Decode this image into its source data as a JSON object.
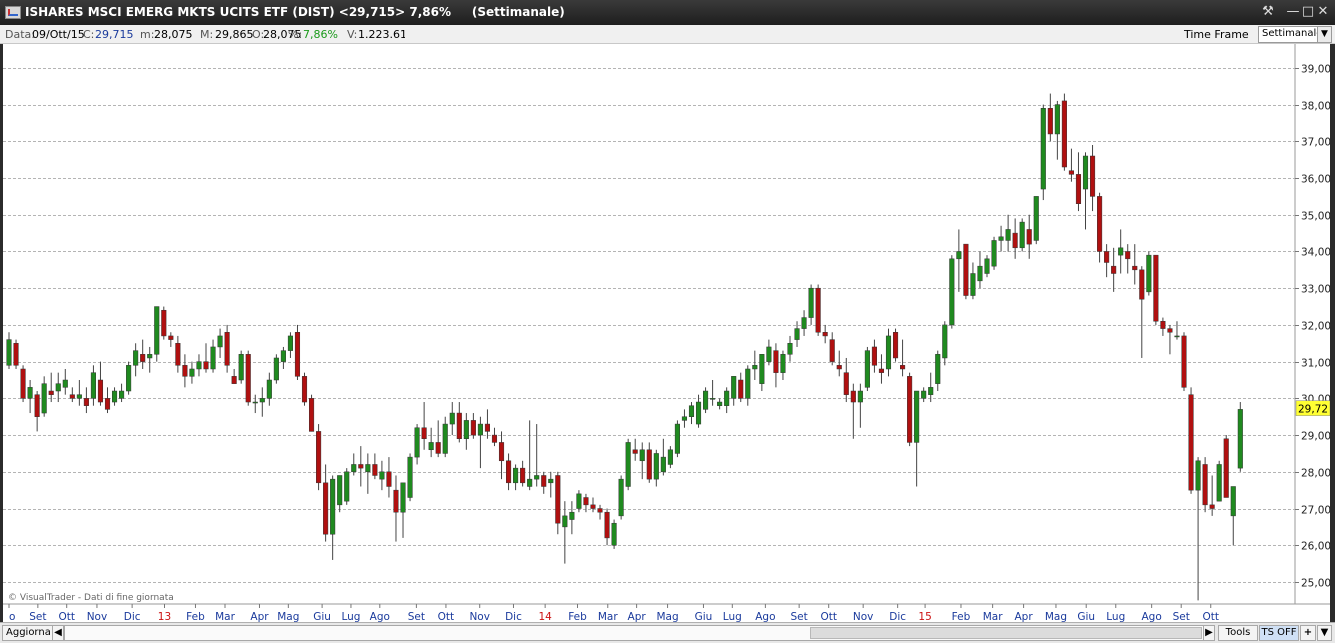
{
  "window": {
    "title": "ISHARES MSCI EMERG MKTS UCITS ETF (DIST) <29,715> 7,86%",
    "timeframe_title": "(Settimanale)"
  },
  "info_bar": {
    "data_label": "Data:",
    "data_value": "09/Ott/15",
    "close_label": "C:",
    "close_value": "29,715",
    "min_label": "m:",
    "min_value": "28,075",
    "max_label": "M:",
    "max_value": "29,865",
    "open_label": "O:",
    "open_value": "28,075",
    "pct_label": "%:",
    "pct_value": "7,86%",
    "vol_label": "V:",
    "vol_value": "1.223.619"
  },
  "time_frame_label": "Time Frame",
  "time_frame_selected": "Settimanale",
  "watermark": "© VisualTrader - Dati di fine giornata",
  "bottom": {
    "update_label": "Aggiorna",
    "tools_label": "Tools",
    "ts_label": "TS OFF",
    "plus_label": "+"
  },
  "colors": {
    "up": "#1f8a1f",
    "down": "#b01010",
    "last_price_bg": "#ffff33",
    "axis_month": "#1a3a9c",
    "axis_year": "#cc1111"
  },
  "chart_data": {
    "type": "candlestick",
    "ylim": [
      24.4,
      39.65
    ],
    "y_ticks": [
      "25,00",
      "26,00",
      "27,00",
      "28,00",
      "29,00",
      "30,00",
      "31,00",
      "32,00",
      "33,00",
      "34,00",
      "35,00",
      "36,00",
      "37,00",
      "38,00",
      "39,00"
    ],
    "last_price_label": "29,72",
    "x_labels": [
      {
        "t": "o",
        "i": 0
      },
      {
        "t": "Set",
        "i": 4.1
      },
      {
        "t": "Ott",
        "i": 8.2
      },
      {
        "t": "Nov",
        "i": 12.5
      },
      {
        "t": "Dic",
        "i": 17.5
      },
      {
        "t": "13",
        "i": 22.1,
        "year": true
      },
      {
        "t": "Feb",
        "i": 26.5
      },
      {
        "t": "Mar",
        "i": 30.7
      },
      {
        "t": "Apr",
        "i": 35.6
      },
      {
        "t": "Mag",
        "i": 39.7
      },
      {
        "t": "Giu",
        "i": 44.5
      },
      {
        "t": "Lug",
        "i": 48.6
      },
      {
        "t": "Ago",
        "i": 52.7
      },
      {
        "t": "Set",
        "i": 57.9
      },
      {
        "t": "Ott",
        "i": 62.1
      },
      {
        "t": "Nov",
        "i": 66.9
      },
      {
        "t": "Dic",
        "i": 71.7
      },
      {
        "t": "14",
        "i": 76.2,
        "year": true
      },
      {
        "t": "Feb",
        "i": 80.8
      },
      {
        "t": "Mar",
        "i": 85.1
      },
      {
        "t": "Apr",
        "i": 89.2
      },
      {
        "t": "Mag",
        "i": 93.6
      },
      {
        "t": "Giu",
        "i": 98.7
      },
      {
        "t": "Lug",
        "i": 102.8
      },
      {
        "t": "Ago",
        "i": 107.5
      },
      {
        "t": "Set",
        "i": 112.3
      },
      {
        "t": "Ott",
        "i": 116.5
      },
      {
        "t": "Nov",
        "i": 121.4
      },
      {
        "t": "Dic",
        "i": 126.3
      },
      {
        "t": "15",
        "i": 130.2,
        "year": true
      },
      {
        "t": "Feb",
        "i": 135.3
      },
      {
        "t": "Mar",
        "i": 139.8
      },
      {
        "t": "Apr",
        "i": 144.2
      },
      {
        "t": "Mag",
        "i": 148.8
      },
      {
        "t": "Giu",
        "i": 153.1
      },
      {
        "t": "Lug",
        "i": 157.3
      },
      {
        "t": "Ago",
        "i": 162.4
      },
      {
        "t": "Set",
        "i": 166.6
      },
      {
        "t": "Ott",
        "i": 170.8
      }
    ],
    "candles": [
      {
        "o": 30.9,
        "h": 31.8,
        "l": 30.8,
        "c": 31.6
      },
      {
        "o": 31.5,
        "h": 31.6,
        "l": 30.8,
        "c": 30.9
      },
      {
        "o": 30.8,
        "h": 30.9,
        "l": 29.9,
        "c": 30.0
      },
      {
        "o": 30.0,
        "h": 30.5,
        "l": 29.6,
        "c": 30.3
      },
      {
        "o": 30.1,
        "h": 30.2,
        "l": 29.1,
        "c": 29.5
      },
      {
        "o": 29.6,
        "h": 30.6,
        "l": 29.5,
        "c": 30.4
      },
      {
        "o": 30.2,
        "h": 30.7,
        "l": 29.9,
        "c": 30.1
      },
      {
        "o": 30.2,
        "h": 30.7,
        "l": 29.9,
        "c": 30.4
      },
      {
        "o": 30.3,
        "h": 30.8,
        "l": 30.1,
        "c": 30.5
      },
      {
        "o": 30.1,
        "h": 30.3,
        "l": 29.9,
        "c": 30.0
      },
      {
        "o": 30.0,
        "h": 30.5,
        "l": 29.8,
        "c": 30.1
      },
      {
        "o": 30.0,
        "h": 30.3,
        "l": 29.6,
        "c": 29.8
      },
      {
        "o": 30.0,
        "h": 30.9,
        "l": 29.8,
        "c": 30.7
      },
      {
        "o": 30.5,
        "h": 31.0,
        "l": 29.8,
        "c": 29.9
      },
      {
        "o": 30.0,
        "h": 30.3,
        "l": 29.6,
        "c": 29.7
      },
      {
        "o": 29.9,
        "h": 30.3,
        "l": 29.8,
        "c": 30.2
      },
      {
        "o": 30.0,
        "h": 30.4,
        "l": 29.9,
        "c": 30.2
      },
      {
        "o": 30.2,
        "h": 31.0,
        "l": 30.1,
        "c": 30.9
      },
      {
        "o": 30.9,
        "h": 31.5,
        "l": 30.6,
        "c": 31.3
      },
      {
        "o": 31.2,
        "h": 31.6,
        "l": 30.8,
        "c": 31.0
      },
      {
        "o": 31.1,
        "h": 31.4,
        "l": 30.7,
        "c": 31.2
      },
      {
        "o": 31.2,
        "h": 32.5,
        "l": 31.0,
        "c": 32.5
      },
      {
        "o": 32.4,
        "h": 32.5,
        "l": 31.6,
        "c": 31.7
      },
      {
        "o": 31.7,
        "h": 31.8,
        "l": 31.4,
        "c": 31.6
      },
      {
        "o": 31.5,
        "h": 31.7,
        "l": 30.7,
        "c": 30.9
      },
      {
        "o": 30.9,
        "h": 31.2,
        "l": 30.3,
        "c": 30.6
      },
      {
        "o": 30.6,
        "h": 31.0,
        "l": 30.4,
        "c": 30.8
      },
      {
        "o": 30.8,
        "h": 31.2,
        "l": 30.6,
        "c": 31.0
      },
      {
        "o": 31.0,
        "h": 31.5,
        "l": 30.7,
        "c": 30.8
      },
      {
        "o": 30.8,
        "h": 31.6,
        "l": 30.7,
        "c": 31.4
      },
      {
        "o": 31.4,
        "h": 31.9,
        "l": 31.1,
        "c": 31.7
      },
      {
        "o": 31.8,
        "h": 32.0,
        "l": 30.7,
        "c": 30.9
      },
      {
        "o": 30.6,
        "h": 30.8,
        "l": 30.4,
        "c": 30.4
      },
      {
        "o": 30.5,
        "h": 31.3,
        "l": 30.4,
        "c": 31.2
      },
      {
        "o": 31.2,
        "h": 31.3,
        "l": 29.8,
        "c": 29.9
      },
      {
        "o": 29.9,
        "h": 30.1,
        "l": 29.6,
        "c": 29.9
      },
      {
        "o": 29.9,
        "h": 30.3,
        "l": 29.5,
        "c": 30.0
      },
      {
        "o": 30.0,
        "h": 30.7,
        "l": 29.8,
        "c": 30.5
      },
      {
        "o": 30.5,
        "h": 31.2,
        "l": 30.4,
        "c": 31.1
      },
      {
        "o": 31.0,
        "h": 31.4,
        "l": 30.8,
        "c": 31.3
      },
      {
        "o": 31.3,
        "h": 31.8,
        "l": 31.1,
        "c": 31.7
      },
      {
        "o": 31.8,
        "h": 32.0,
        "l": 30.5,
        "c": 30.6
      },
      {
        "o": 30.6,
        "h": 30.7,
        "l": 29.8,
        "c": 29.9
      },
      {
        "o": 30.0,
        "h": 30.1,
        "l": 29.1,
        "c": 29.1
      },
      {
        "o": 29.1,
        "h": 29.3,
        "l": 27.5,
        "c": 27.7
      },
      {
        "o": 27.7,
        "h": 28.2,
        "l": 26.1,
        "c": 26.3
      },
      {
        "o": 26.3,
        "h": 27.9,
        "l": 25.6,
        "c": 27.8
      },
      {
        "o": 27.1,
        "h": 27.9,
        "l": 26.9,
        "c": 27.9
      },
      {
        "o": 27.2,
        "h": 28.1,
        "l": 27.1,
        "c": 28.0
      },
      {
        "o": 28.0,
        "h": 28.5,
        "l": 27.9,
        "c": 28.2
      },
      {
        "o": 28.2,
        "h": 28.7,
        "l": 27.6,
        "c": 28.1
      },
      {
        "o": 28.0,
        "h": 28.5,
        "l": 27.4,
        "c": 28.2
      },
      {
        "o": 28.2,
        "h": 28.5,
        "l": 27.8,
        "c": 27.9
      },
      {
        "o": 27.8,
        "h": 28.3,
        "l": 27.5,
        "c": 28.0
      },
      {
        "o": 28.0,
        "h": 28.4,
        "l": 27.3,
        "c": 27.6
      },
      {
        "o": 27.5,
        "h": 27.9,
        "l": 26.1,
        "c": 26.9
      },
      {
        "o": 26.9,
        "h": 27.4,
        "l": 26.2,
        "c": 27.7
      },
      {
        "o": 27.3,
        "h": 28.5,
        "l": 27.2,
        "c": 28.4
      },
      {
        "o": 28.4,
        "h": 29.3,
        "l": 28.2,
        "c": 29.2
      },
      {
        "o": 29.2,
        "h": 29.9,
        "l": 28.6,
        "c": 28.9
      },
      {
        "o": 28.6,
        "h": 29.2,
        "l": 28.4,
        "c": 28.8
      },
      {
        "o": 28.8,
        "h": 29.4,
        "l": 28.4,
        "c": 28.5
      },
      {
        "o": 28.5,
        "h": 29.5,
        "l": 28.4,
        "c": 29.3
      },
      {
        "o": 29.3,
        "h": 29.9,
        "l": 29.0,
        "c": 29.6
      },
      {
        "o": 29.6,
        "h": 29.9,
        "l": 28.8,
        "c": 28.9
      },
      {
        "o": 28.9,
        "h": 29.6,
        "l": 28.6,
        "c": 29.4
      },
      {
        "o": 29.4,
        "h": 29.6,
        "l": 28.9,
        "c": 29.0
      },
      {
        "o": 29.0,
        "h": 29.5,
        "l": 28.1,
        "c": 29.3
      },
      {
        "o": 29.3,
        "h": 29.7,
        "l": 28.9,
        "c": 29.1
      },
      {
        "o": 29.0,
        "h": 29.2,
        "l": 28.7,
        "c": 28.8
      },
      {
        "o": 28.8,
        "h": 29.1,
        "l": 27.8,
        "c": 28.3
      },
      {
        "o": 28.3,
        "h": 28.5,
        "l": 27.5,
        "c": 27.7
      },
      {
        "o": 27.7,
        "h": 28.2,
        "l": 27.5,
        "c": 28.1
      },
      {
        "o": 28.1,
        "h": 28.3,
        "l": 27.6,
        "c": 27.7
      },
      {
        "o": 27.6,
        "h": 29.4,
        "l": 27.5,
        "c": 27.8
      },
      {
        "o": 27.8,
        "h": 29.3,
        "l": 27.6,
        "c": 27.9
      },
      {
        "o": 27.9,
        "h": 28.0,
        "l": 27.4,
        "c": 27.6
      },
      {
        "o": 27.7,
        "h": 28.0,
        "l": 27.3,
        "c": 27.8
      },
      {
        "o": 27.9,
        "h": 28.0,
        "l": 26.3,
        "c": 26.6
      },
      {
        "o": 26.5,
        "h": 27.2,
        "l": 25.5,
        "c": 26.8
      },
      {
        "o": 26.7,
        "h": 27.2,
        "l": 26.3,
        "c": 26.9
      },
      {
        "o": 27.0,
        "h": 27.5,
        "l": 26.9,
        "c": 27.4
      },
      {
        "o": 27.3,
        "h": 27.4,
        "l": 26.9,
        "c": 27.1
      },
      {
        "o": 27.1,
        "h": 27.3,
        "l": 26.9,
        "c": 27.0
      },
      {
        "o": 27.0,
        "h": 27.1,
        "l": 26.7,
        "c": 26.9
      },
      {
        "o": 26.9,
        "h": 27.0,
        "l": 26.0,
        "c": 26.2
      },
      {
        "o": 26.0,
        "h": 26.7,
        "l": 25.9,
        "c": 26.6
      },
      {
        "o": 26.8,
        "h": 27.9,
        "l": 26.7,
        "c": 27.8
      },
      {
        "o": 27.6,
        "h": 28.9,
        "l": 27.5,
        "c": 28.8
      },
      {
        "o": 28.6,
        "h": 28.9,
        "l": 28.3,
        "c": 28.5
      },
      {
        "o": 28.3,
        "h": 28.8,
        "l": 27.8,
        "c": 28.6
      },
      {
        "o": 28.6,
        "h": 28.8,
        "l": 27.7,
        "c": 27.8
      },
      {
        "o": 27.8,
        "h": 28.6,
        "l": 27.6,
        "c": 28.5
      },
      {
        "o": 28.0,
        "h": 28.9,
        "l": 27.9,
        "c": 28.4
      },
      {
        "o": 28.2,
        "h": 28.7,
        "l": 28.1,
        "c": 28.6
      },
      {
        "o": 28.5,
        "h": 29.4,
        "l": 28.4,
        "c": 29.3
      },
      {
        "o": 29.4,
        "h": 29.7,
        "l": 29.2,
        "c": 29.5
      },
      {
        "o": 29.5,
        "h": 29.9,
        "l": 29.3,
        "c": 29.8
      },
      {
        "o": 29.3,
        "h": 30.1,
        "l": 29.2,
        "c": 29.9
      },
      {
        "o": 29.7,
        "h": 30.3,
        "l": 29.6,
        "c": 30.2
      },
      {
        "o": 30.0,
        "h": 30.5,
        "l": 29.8,
        "c": 30.0
      },
      {
        "o": 29.8,
        "h": 30.0,
        "l": 29.7,
        "c": 29.9
      },
      {
        "o": 29.8,
        "h": 30.3,
        "l": 29.6,
        "c": 30.2
      },
      {
        "o": 30.0,
        "h": 30.6,
        "l": 29.8,
        "c": 30.6
      },
      {
        "o": 30.5,
        "h": 30.7,
        "l": 29.9,
        "c": 30.0
      },
      {
        "o": 30.0,
        "h": 30.9,
        "l": 29.8,
        "c": 30.8
      },
      {
        "o": 30.8,
        "h": 31.3,
        "l": 30.5,
        "c": 30.9
      },
      {
        "o": 30.4,
        "h": 31.2,
        "l": 30.2,
        "c": 31.2
      },
      {
        "o": 31.0,
        "h": 31.6,
        "l": 30.9,
        "c": 31.4
      },
      {
        "o": 31.3,
        "h": 31.5,
        "l": 30.3,
        "c": 30.7
      },
      {
        "o": 30.7,
        "h": 31.3,
        "l": 30.5,
        "c": 31.2
      },
      {
        "o": 31.2,
        "h": 31.7,
        "l": 31.0,
        "c": 31.5
      },
      {
        "o": 31.6,
        "h": 32.1,
        "l": 31.4,
        "c": 31.9
      },
      {
        "o": 31.9,
        "h": 32.4,
        "l": 31.7,
        "c": 32.2
      },
      {
        "o": 32.2,
        "h": 33.1,
        "l": 32.0,
        "c": 33.0
      },
      {
        "o": 33.0,
        "h": 33.1,
        "l": 31.7,
        "c": 31.8
      },
      {
        "o": 31.8,
        "h": 32.0,
        "l": 31.5,
        "c": 31.7
      },
      {
        "o": 31.6,
        "h": 31.8,
        "l": 30.9,
        "c": 31.0
      },
      {
        "o": 30.9,
        "h": 31.3,
        "l": 30.6,
        "c": 30.8
      },
      {
        "o": 30.7,
        "h": 31.1,
        "l": 29.9,
        "c": 30.1
      },
      {
        "o": 30.2,
        "h": 30.4,
        "l": 28.9,
        "c": 29.9
      },
      {
        "o": 29.9,
        "h": 30.4,
        "l": 29.2,
        "c": 30.2
      },
      {
        "o": 30.3,
        "h": 31.4,
        "l": 30.2,
        "c": 31.3
      },
      {
        "o": 31.4,
        "h": 31.6,
        "l": 30.7,
        "c": 30.9
      },
      {
        "o": 30.8,
        "h": 31.2,
        "l": 30.4,
        "c": 30.7
      },
      {
        "o": 30.8,
        "h": 31.9,
        "l": 30.6,
        "c": 31.7
      },
      {
        "o": 31.8,
        "h": 31.9,
        "l": 31.0,
        "c": 31.1
      },
      {
        "o": 30.9,
        "h": 31.6,
        "l": 30.6,
        "c": 30.8
      },
      {
        "o": 30.6,
        "h": 30.7,
        "l": 28.7,
        "c": 28.8
      },
      {
        "o": 28.8,
        "h": 30.2,
        "l": 27.6,
        "c": 30.2
      },
      {
        "o": 30.0,
        "h": 30.3,
        "l": 29.9,
        "c": 30.2
      },
      {
        "o": 30.1,
        "h": 30.7,
        "l": 29.9,
        "c": 30.3
      },
      {
        "o": 30.4,
        "h": 31.3,
        "l": 30.2,
        "c": 31.2
      },
      {
        "o": 31.1,
        "h": 32.1,
        "l": 30.9,
        "c": 32.0
      },
      {
        "o": 32.0,
        "h": 33.9,
        "l": 31.9,
        "c": 33.8
      },
      {
        "o": 33.8,
        "h": 34.6,
        "l": 32.9,
        "c": 34.0
      },
      {
        "o": 34.2,
        "h": 34.2,
        "l": 32.7,
        "c": 32.8
      },
      {
        "o": 32.8,
        "h": 33.7,
        "l": 32.7,
        "c": 33.4
      },
      {
        "o": 33.2,
        "h": 34.0,
        "l": 33.0,
        "c": 33.6
      },
      {
        "o": 33.4,
        "h": 33.9,
        "l": 33.3,
        "c": 33.8
      },
      {
        "o": 33.6,
        "h": 34.4,
        "l": 33.5,
        "c": 34.3
      },
      {
        "o": 34.3,
        "h": 34.7,
        "l": 34.0,
        "c": 34.4
      },
      {
        "o": 34.3,
        "h": 35.0,
        "l": 34.0,
        "c": 34.6
      },
      {
        "o": 34.5,
        "h": 34.9,
        "l": 33.8,
        "c": 34.1
      },
      {
        "o": 34.1,
        "h": 34.9,
        "l": 34.0,
        "c": 34.8
      },
      {
        "o": 34.6,
        "h": 35.0,
        "l": 33.8,
        "c": 34.2
      },
      {
        "o": 34.3,
        "h": 35.5,
        "l": 34.2,
        "c": 35.5
      },
      {
        "o": 35.7,
        "h": 38.0,
        "l": 35.4,
        "c": 37.9
      },
      {
        "o": 37.9,
        "h": 38.3,
        "l": 37.0,
        "c": 37.2
      },
      {
        "o": 37.2,
        "h": 38.1,
        "l": 36.5,
        "c": 38.0
      },
      {
        "o": 38.1,
        "h": 38.3,
        "l": 36.2,
        "c": 36.3
      },
      {
        "o": 36.2,
        "h": 36.8,
        "l": 35.9,
        "c": 36.1
      },
      {
        "o": 36.1,
        "h": 36.7,
        "l": 35.1,
        "c": 35.3
      },
      {
        "o": 35.7,
        "h": 36.7,
        "l": 34.6,
        "c": 36.6
      },
      {
        "o": 36.6,
        "h": 36.9,
        "l": 35.1,
        "c": 35.5
      },
      {
        "o": 35.5,
        "h": 35.6,
        "l": 33.7,
        "c": 34.0
      },
      {
        "o": 34.0,
        "h": 34.2,
        "l": 33.3,
        "c": 33.7
      },
      {
        "o": 33.6,
        "h": 34.1,
        "l": 32.9,
        "c": 33.4
      },
      {
        "o": 33.9,
        "h": 34.6,
        "l": 33.4,
        "c": 34.1
      },
      {
        "o": 34.0,
        "h": 34.2,
        "l": 33.4,
        "c": 33.8
      },
      {
        "o": 33.6,
        "h": 34.2,
        "l": 33.1,
        "c": 33.5
      },
      {
        "o": 33.5,
        "h": 33.6,
        "l": 31.1,
        "c": 32.7
      },
      {
        "o": 32.9,
        "h": 34.0,
        "l": 32.8,
        "c": 33.9
      },
      {
        "o": 33.9,
        "h": 33.9,
        "l": 32.0,
        "c": 32.1
      },
      {
        "o": 32.1,
        "h": 32.2,
        "l": 31.7,
        "c": 31.9
      },
      {
        "o": 31.9,
        "h": 32.0,
        "l": 31.2,
        "c": 31.8
      },
      {
        "o": 31.7,
        "h": 32.1,
        "l": 31.6,
        "c": 31.7
      },
      {
        "o": 31.7,
        "h": 31.8,
        "l": 30.2,
        "c": 30.3
      },
      {
        "o": 30.1,
        "h": 30.3,
        "l": 27.4,
        "c": 27.5
      },
      {
        "o": 27.5,
        "h": 28.4,
        "l": 24.5,
        "c": 28.3
      },
      {
        "o": 28.2,
        "h": 28.4,
        "l": 26.9,
        "c": 27.1
      },
      {
        "o": 27.1,
        "h": 27.9,
        "l": 26.8,
        "c": 27.0
      },
      {
        "o": 27.2,
        "h": 28.3,
        "l": 27.2,
        "c": 28.2
      },
      {
        "o": 28.9,
        "h": 29.0,
        "l": 27.3,
        "c": 27.3
      },
      {
        "o": 26.8,
        "h": 27.6,
        "l": 26.0,
        "c": 27.6
      },
      {
        "o": 28.1,
        "h": 29.9,
        "l": 28.0,
        "c": 29.7
      }
    ]
  }
}
